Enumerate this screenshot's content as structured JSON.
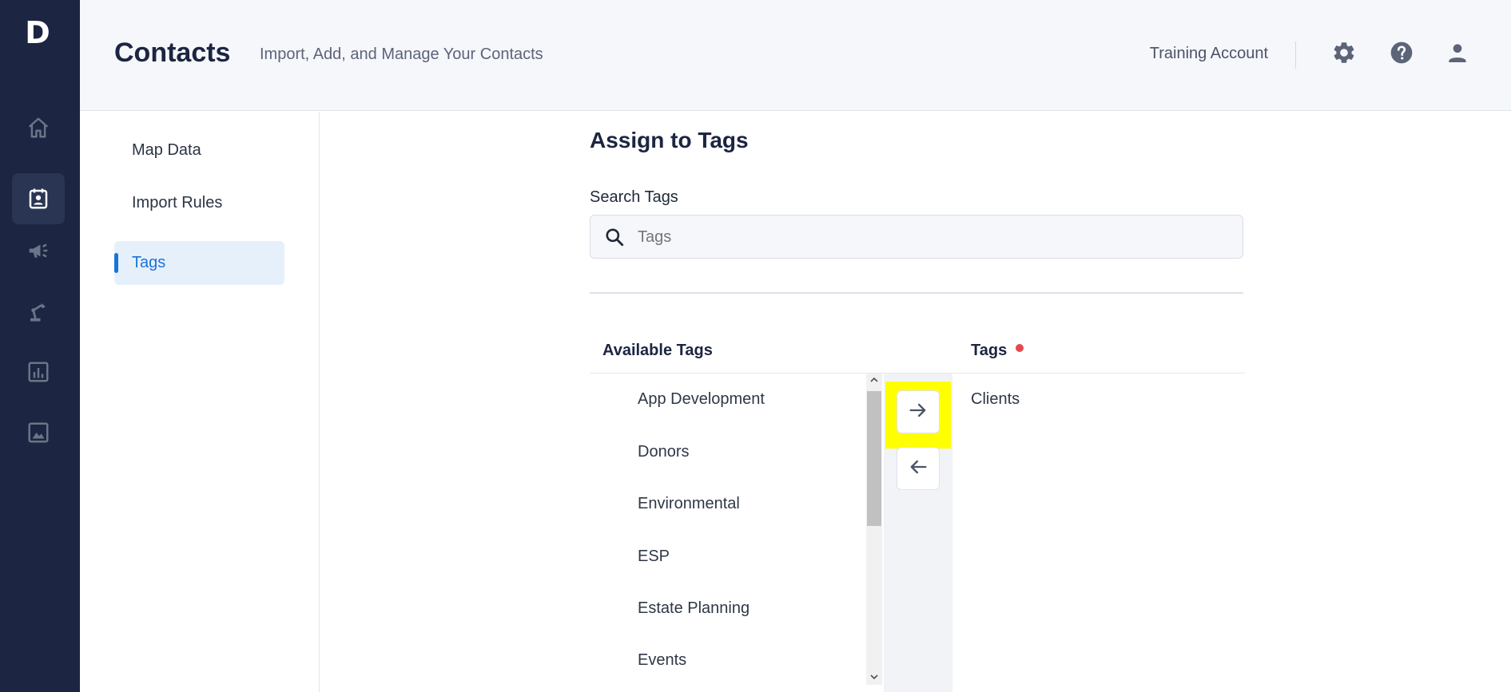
{
  "app": {
    "logo_letter": "D"
  },
  "rail": {
    "items": [
      {
        "icon": "home-icon"
      },
      {
        "icon": "contacts-icon",
        "active": true
      },
      {
        "icon": "megaphone-icon"
      },
      {
        "icon": "automation-icon"
      },
      {
        "icon": "reports-icon"
      },
      {
        "icon": "image-icon"
      }
    ]
  },
  "header": {
    "title": "Contacts",
    "subtitle": "Import, Add, and Manage Your Contacts",
    "account": "Training Account",
    "icons": [
      "gear-icon",
      "help-icon",
      "user-icon"
    ]
  },
  "subnav": {
    "items": [
      {
        "label": "Map Data"
      },
      {
        "label": "Import Rules"
      },
      {
        "label": "Tags",
        "active": true
      }
    ]
  },
  "main": {
    "section_title": "Assign to Tags",
    "search": {
      "label": "Search Tags",
      "placeholder": "Tags",
      "value": ""
    },
    "available": {
      "heading": "Available Tags",
      "items": [
        "App Development",
        "Donors",
        "Environmental",
        "ESP",
        "Estate Planning",
        "Events"
      ]
    },
    "assigned": {
      "heading": "Tags",
      "required": true,
      "items": [
        "Clients"
      ]
    },
    "colors": {
      "accent": "#1a73d9",
      "required_dot": "#e5484d",
      "highlight": "#ffff00",
      "rail": "#1c2541"
    }
  }
}
